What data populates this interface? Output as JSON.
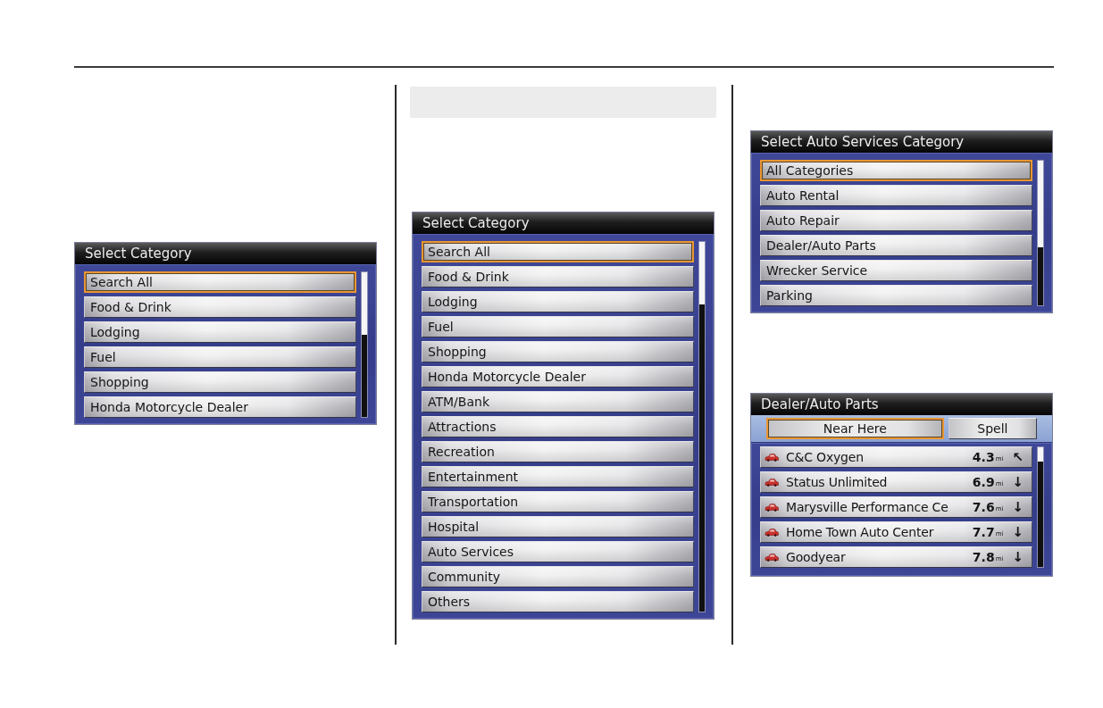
{
  "columns": [
    {
      "screens": [
        {
          "kind": "menu",
          "title": "Select Category",
          "items": [
            {
              "label": "Search All",
              "selected": true
            },
            {
              "label": "Food & Drink",
              "selected": false
            },
            {
              "label": "Lodging",
              "selected": false
            },
            {
              "label": "Fuel",
              "selected": false
            },
            {
              "label": "Shopping",
              "selected": false
            },
            {
              "label": "Honda Motorcycle Dealer",
              "selected": false
            }
          ]
        }
      ]
    },
    {
      "screens": [
        {
          "kind": "menu",
          "title": "Select Category",
          "items": [
            {
              "label": "Search All",
              "selected": true
            },
            {
              "label": "Food & Drink",
              "selected": false
            },
            {
              "label": "Lodging",
              "selected": false
            },
            {
              "label": "Fuel",
              "selected": false
            },
            {
              "label": "Shopping",
              "selected": false
            },
            {
              "label": "Honda Motorcycle Dealer",
              "selected": false
            },
            {
              "label": "ATM/Bank",
              "selected": false
            },
            {
              "label": "Attractions",
              "selected": false
            },
            {
              "label": "Recreation",
              "selected": false
            },
            {
              "label": "Entertainment",
              "selected": false
            },
            {
              "label": "Transportation",
              "selected": false
            },
            {
              "label": "Hospital",
              "selected": false
            },
            {
              "label": "Auto Services",
              "selected": false
            },
            {
              "label": "Community",
              "selected": false
            },
            {
              "label": "Others",
              "selected": false
            }
          ]
        }
      ]
    },
    {
      "screens": [
        {
          "kind": "menu",
          "title": "Select Auto Services Category",
          "items": [
            {
              "label": "All Categories",
              "selected": true
            },
            {
              "label": "Auto Rental",
              "selected": false
            },
            {
              "label": "Auto Repair",
              "selected": false
            },
            {
              "label": "Dealer/Auto Parts",
              "selected": false
            },
            {
              "label": "Wrecker Service",
              "selected": false
            },
            {
              "label": "Parking",
              "selected": false
            }
          ]
        },
        {
          "kind": "results",
          "title": "Dealer/Auto Parts",
          "buttons": [
            {
              "label": "Near Here",
              "selected": true
            },
            {
              "label": "Spell",
              "selected": false
            }
          ],
          "rows": [
            {
              "name": "C&C Oxygen",
              "distance": "4.3",
              "unit": "mi",
              "arrow": "↖"
            },
            {
              "name": "Status Unlimited",
              "distance": "6.9",
              "unit": "mi",
              "arrow": "↓"
            },
            {
              "name": "Marysville Performance Ce",
              "distance": "7.6",
              "unit": "mi",
              "arrow": "↓"
            },
            {
              "name": "Home Town Auto Center",
              "distance": "7.7",
              "unit": "mi",
              "arrow": "↓"
            },
            {
              "name": "Goodyear",
              "distance": "7.8",
              "unit": "mi",
              "arrow": "↓"
            }
          ]
        }
      ]
    }
  ]
}
